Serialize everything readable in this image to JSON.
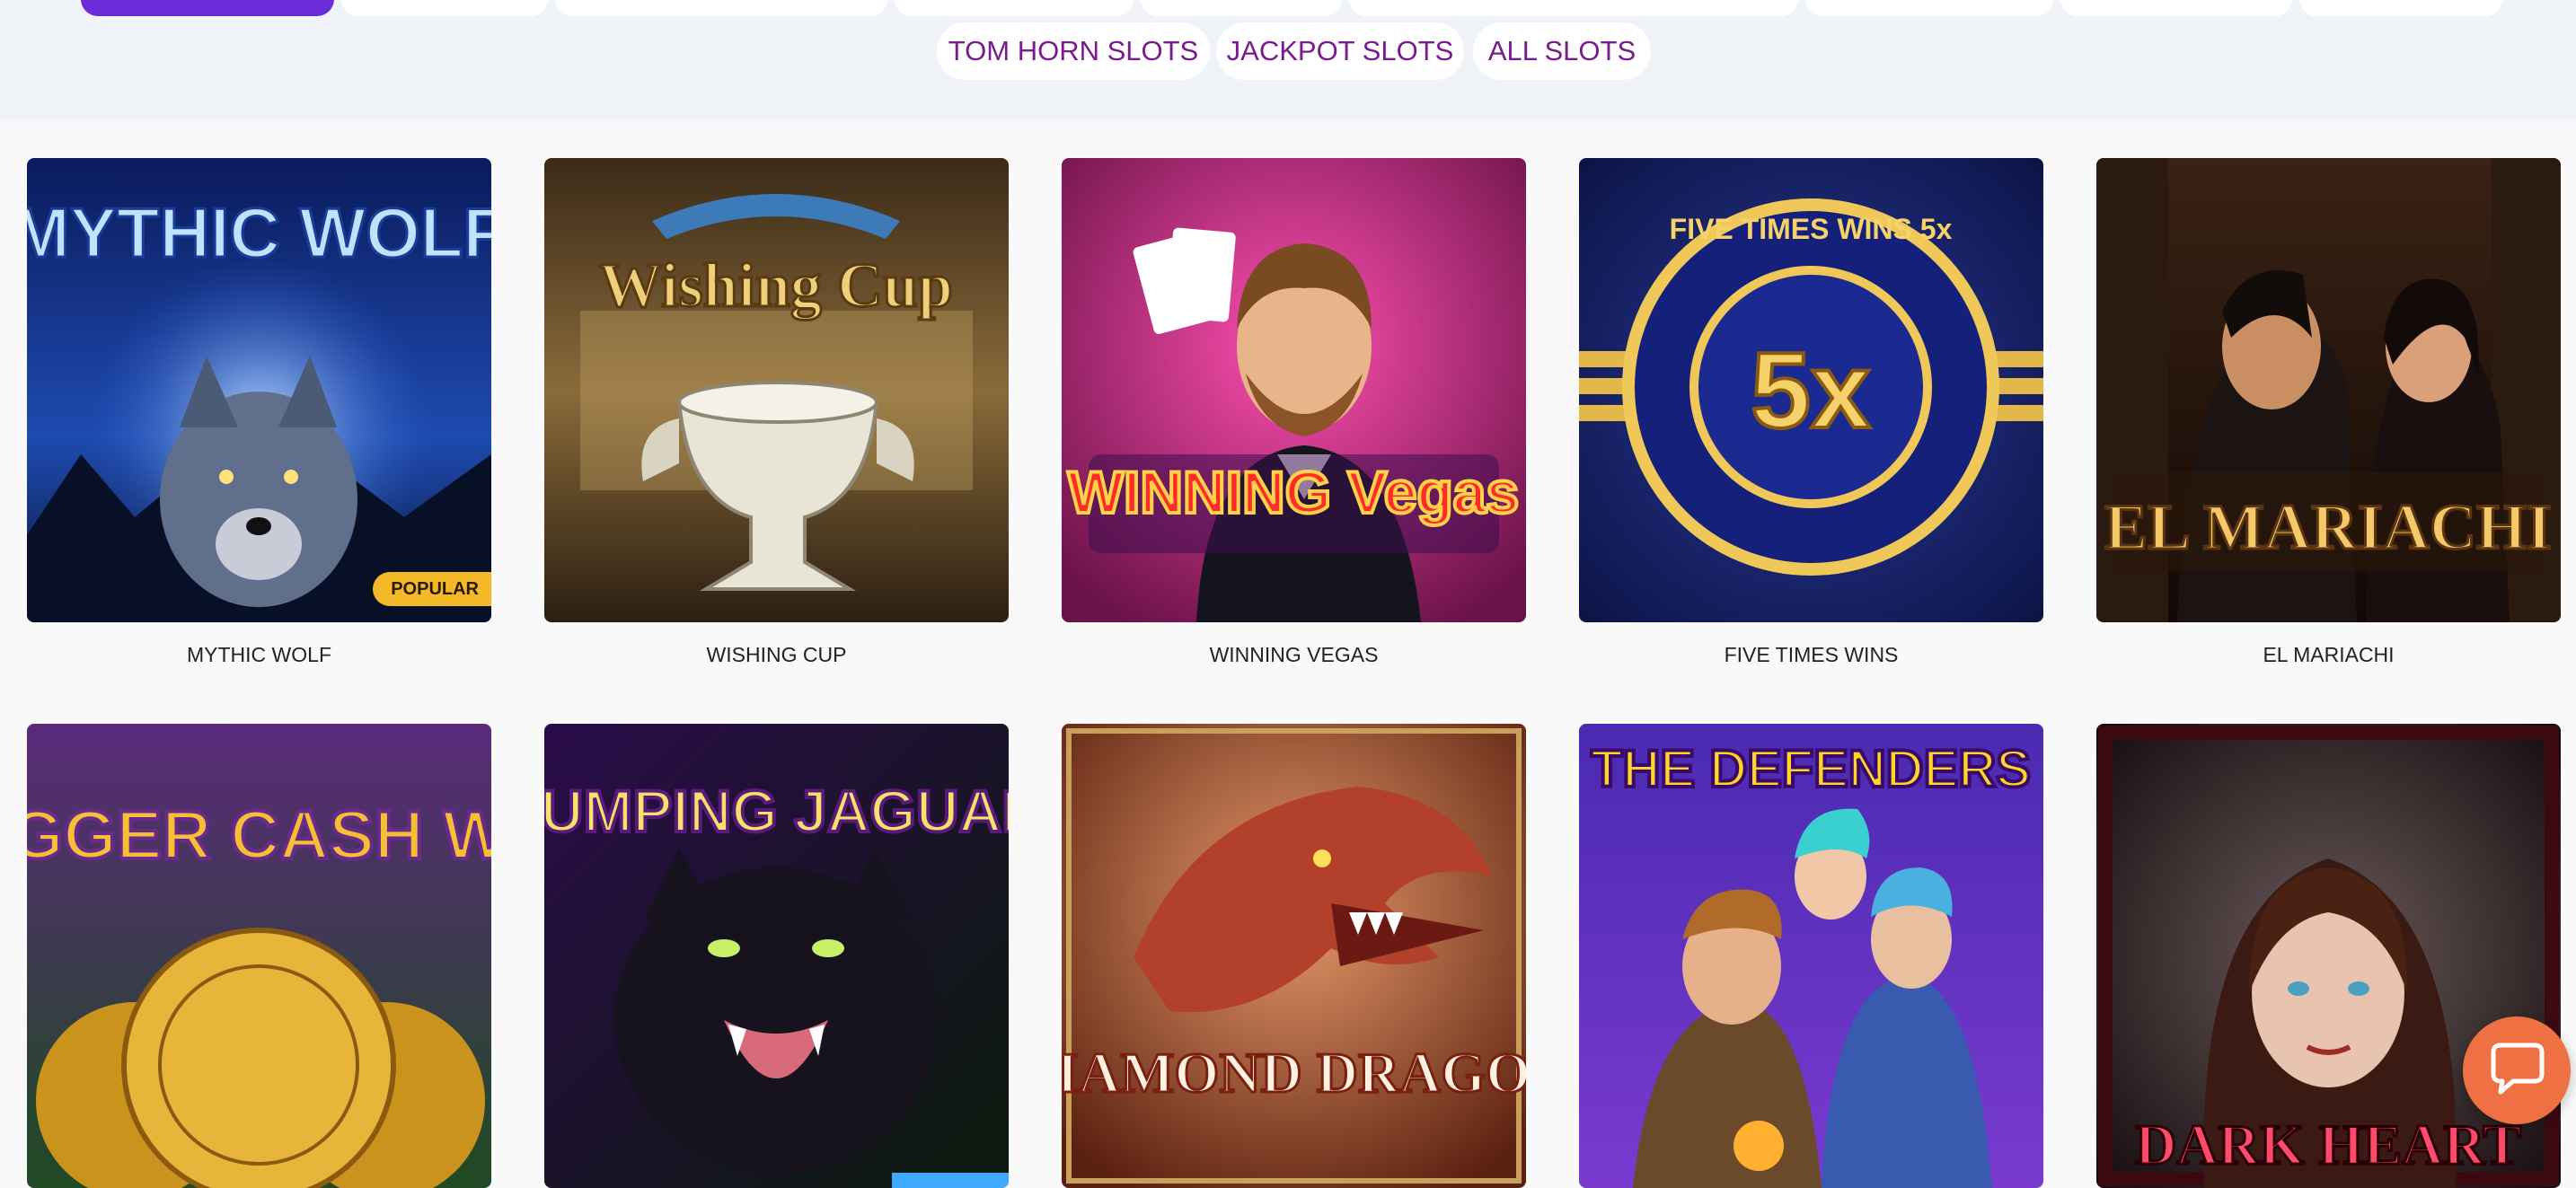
{
  "filters": {
    "pills": [
      {
        "label": "TOM HORN SLOTS"
      },
      {
        "label": "JACKPOT SLOTS"
      },
      {
        "label": "ALL SLOTS"
      }
    ]
  },
  "games": [
    {
      "title": "MYTHIC WOLF",
      "art_text": "MYTHIC WOLF",
      "badge": "POPULAR"
    },
    {
      "title": "WISHING CUP",
      "art_text": "Wishing Cup"
    },
    {
      "title": "WINNING VEGAS",
      "art_text": "WINNING Vegas"
    },
    {
      "title": "FIVE TIMES WINS",
      "art_text": "FIVE TIMES WINS 5x"
    },
    {
      "title": "EL MARIACHI",
      "art_text": "EL MARIACHI"
    },
    {
      "art_text": "BIGGER CASH WIN"
    },
    {
      "art_text": "JUMPING JAGUAR"
    },
    {
      "art_text": "DIAMOND DRAGON"
    },
    {
      "art_text": "THE DEFENDERS"
    },
    {
      "art_text": "DARK HEART"
    }
  ],
  "colors": {
    "accent": "#6c2bd9",
    "pill_text": "#7a1a8f",
    "badge": "#f3b927",
    "chat": "#ef7043"
  },
  "icons": {
    "chat": "chat-bubble-icon"
  }
}
